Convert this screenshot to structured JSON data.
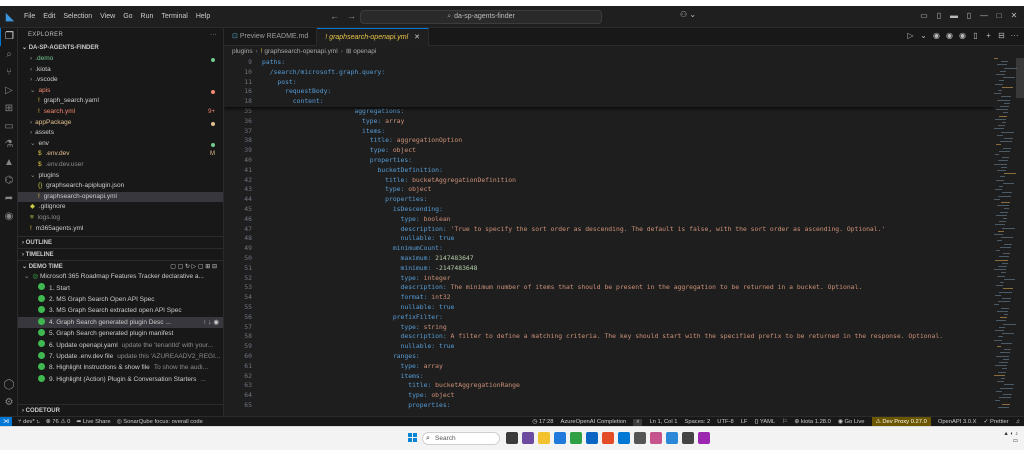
{
  "menu": [
    "File",
    "Edit",
    "Selection",
    "View",
    "Go",
    "Run",
    "Terminal",
    "Help"
  ],
  "command_center": "da-sp-agents-finder",
  "explorer": {
    "header": "EXPLORER",
    "project": "DA-SP-AGENTS-FINDER",
    "items": [
      {
        "label": ".demo",
        "color": "#73c991",
        "indent": 1,
        "chev": "›",
        "mark": "dot-green"
      },
      {
        "label": ".kiota",
        "color": "#cccccc",
        "indent": 1,
        "chev": "›",
        "mark": ""
      },
      {
        "label": ".vscode",
        "color": "#cccccc",
        "indent": 1,
        "chev": "›",
        "mark": ""
      },
      {
        "label": "apis",
        "color": "#f48771",
        "indent": 1,
        "chev": "⌄",
        "mark": "dot-red"
      },
      {
        "label": "graph_search.yaml",
        "color": "#cccccc",
        "indent": 2,
        "icon": "!",
        "mark": ""
      },
      {
        "label": "search.yml",
        "color": "#f48771",
        "indent": 2,
        "icon": "!",
        "mark": "9+"
      },
      {
        "label": "appPackage",
        "color": "#e2c08d",
        "indent": 1,
        "chev": "›",
        "mark": "dot-orange"
      },
      {
        "label": "assets",
        "color": "#cccccc",
        "indent": 1,
        "chev": "›",
        "mark": ""
      },
      {
        "label": "env",
        "color": "#cccccc",
        "indent": 1,
        "chev": "⌄",
        "mark": "dot-green"
      },
      {
        "label": ".env.dev",
        "color": "#e2c08d",
        "indent": 2,
        "icon": "$",
        "mark": "M"
      },
      {
        "label": ".env.dev.user",
        "color": "#8c8c8c",
        "indent": 2,
        "icon": "$",
        "mark": ""
      },
      {
        "label": "plugins",
        "color": "#cccccc",
        "indent": 1,
        "chev": "⌄",
        "mark": ""
      },
      {
        "label": "graphsearch-apiplugin.json",
        "color": "#cccccc",
        "indent": 2,
        "icon": "{}",
        "mark": ""
      },
      {
        "label": "graphsearch-openapi.yml",
        "color": "#cccccc",
        "indent": 2,
        "icon": "!",
        "mark": "",
        "selected": true
      },
      {
        "label": ".gitignore",
        "color": "#cccccc",
        "indent": 1,
        "icon": "◆",
        "mark": ""
      },
      {
        "label": "logs.log",
        "color": "#8c8c8c",
        "indent": 1,
        "icon": "≡",
        "mark": ""
      },
      {
        "label": "m365agents.yml",
        "color": "#cccccc",
        "indent": 1,
        "icon": "!",
        "mark": ""
      }
    ]
  },
  "sections": {
    "outline": "OUTLINE",
    "timeline": "TIMELINE",
    "demo_time": "DEMO TIME",
    "codetour": "CODETOUR"
  },
  "demo": {
    "group": "Microsoft 365 Roadmap Features Tracker declarative a...",
    "steps": [
      {
        "label": "1. Start",
        "desc": ""
      },
      {
        "label": "2. MS Graph Search Open API Spec",
        "desc": ""
      },
      {
        "label": "3. MS Graph Search extracted open API Spec",
        "desc": ""
      },
      {
        "label": "4. Graph Search generated plugin Desc ...",
        "desc": "",
        "selected": true
      },
      {
        "label": "5. Graph Search generated plugin manifest",
        "desc": ""
      },
      {
        "label": "6. Update openapi.yaml",
        "desc": "update the 'tenantId' with your..."
      },
      {
        "label": "7. Update .env.dev file",
        "desc": "update this 'AZUREAADV2_REGI..."
      },
      {
        "label": "8. Highlight Instructions & show file",
        "desc": "To show the audi..."
      },
      {
        "label": "9. Highlight (Action) Plugin & Conversation Starters",
        "desc": "..."
      }
    ]
  },
  "tabs": [
    {
      "label": "Preview README.md",
      "active": false
    },
    {
      "label": "graphsearch-openapi.yml",
      "active": true
    }
  ],
  "breadcrumb": [
    "plugins",
    "graphsearch-openapi.yml",
    "openapi"
  ],
  "sticky_lines": [
    {
      "n": "9",
      "indent": 0,
      "t": [
        [
          "k",
          "paths:"
        ]
      ]
    },
    {
      "n": "10",
      "indent": 1,
      "t": [
        [
          "k",
          "/search/microsoft.graph.query:"
        ]
      ]
    },
    {
      "n": "11",
      "indent": 2,
      "t": [
        [
          "k",
          "post:"
        ]
      ]
    },
    {
      "n": "16",
      "indent": 3,
      "t": [
        [
          "k",
          "requestBody:"
        ]
      ]
    },
    {
      "n": "18",
      "indent": 4,
      "t": [
        [
          "k",
          "content:"
        ]
      ]
    }
  ],
  "code_lines": [
    {
      "n": "35",
      "indent": 12,
      "t": [
        [
          "k",
          "aggregations:"
        ]
      ]
    },
    {
      "n": "36",
      "indent": 13,
      "t": [
        [
          "k",
          "type: "
        ],
        [
          "v",
          "array"
        ]
      ]
    },
    {
      "n": "37",
      "indent": 13,
      "t": [
        [
          "k",
          "items:"
        ]
      ]
    },
    {
      "n": "38",
      "indent": 14,
      "t": [
        [
          "k",
          "title: "
        ],
        [
          "v",
          "aggregationOption"
        ]
      ]
    },
    {
      "n": "39",
      "indent": 14,
      "t": [
        [
          "k",
          "type: "
        ],
        [
          "v",
          "object"
        ]
      ]
    },
    {
      "n": "40",
      "indent": 14,
      "t": [
        [
          "k",
          "properties:"
        ]
      ]
    },
    {
      "n": "41",
      "indent": 15,
      "t": [
        [
          "k",
          "bucketDefinition:"
        ]
      ]
    },
    {
      "n": "42",
      "indent": 16,
      "t": [
        [
          "k",
          "title: "
        ],
        [
          "v",
          "bucketAggregationDefinition"
        ]
      ]
    },
    {
      "n": "43",
      "indent": 16,
      "t": [
        [
          "k",
          "type: "
        ],
        [
          "v",
          "object"
        ]
      ]
    },
    {
      "n": "44",
      "indent": 16,
      "t": [
        [
          "k",
          "properties:"
        ]
      ]
    },
    {
      "n": "45",
      "indent": 17,
      "t": [
        [
          "k",
          "isDescending:"
        ]
      ]
    },
    {
      "n": "46",
      "indent": 18,
      "t": [
        [
          "k",
          "type: "
        ],
        [
          "v",
          "boolean"
        ]
      ]
    },
    {
      "n": "47",
      "indent": 18,
      "t": [
        [
          "k",
          "description: "
        ],
        [
          "v",
          "'True to specify the sort order as descending. The default is false, with the sort order as ascending. Optional.'"
        ]
      ]
    },
    {
      "n": "48",
      "indent": 18,
      "t": [
        [
          "k",
          "nullable: "
        ],
        [
          "b",
          "true"
        ]
      ]
    },
    {
      "n": "49",
      "indent": 17,
      "t": [
        [
          "k",
          "minimumCount:"
        ]
      ]
    },
    {
      "n": "50",
      "indent": 18,
      "t": [
        [
          "k",
          "maximum: "
        ],
        [
          "n",
          "2147483647"
        ]
      ]
    },
    {
      "n": "51",
      "indent": 18,
      "t": [
        [
          "k",
          "minimum: "
        ],
        [
          "n",
          "-2147483648"
        ]
      ]
    },
    {
      "n": "52",
      "indent": 18,
      "t": [
        [
          "k",
          "type: "
        ],
        [
          "v",
          "integer"
        ]
      ]
    },
    {
      "n": "53",
      "indent": 18,
      "t": [
        [
          "k",
          "description: "
        ],
        [
          "v",
          "The minimum number of items that should be present in the aggregation to be returned in a bucket. Optional."
        ]
      ]
    },
    {
      "n": "54",
      "indent": 18,
      "t": [
        [
          "k",
          "format: "
        ],
        [
          "v",
          "int32"
        ]
      ]
    },
    {
      "n": "55",
      "indent": 18,
      "t": [
        [
          "k",
          "nullable: "
        ],
        [
          "b",
          "true"
        ]
      ]
    },
    {
      "n": "56",
      "indent": 17,
      "t": [
        [
          "k",
          "prefixFilter:"
        ]
      ]
    },
    {
      "n": "57",
      "indent": 18,
      "t": [
        [
          "k",
          "type: "
        ],
        [
          "v",
          "string"
        ]
      ]
    },
    {
      "n": "58",
      "indent": 18,
      "t": [
        [
          "k",
          "description: "
        ],
        [
          "v",
          "A filter to define a matching criteria. The key should start with the specified prefix to be returned in the response. Optional."
        ]
      ]
    },
    {
      "n": "59",
      "indent": 18,
      "t": [
        [
          "k",
          "nullable: "
        ],
        [
          "b",
          "true"
        ]
      ]
    },
    {
      "n": "60",
      "indent": 17,
      "t": [
        [
          "k",
          "ranges:"
        ]
      ]
    },
    {
      "n": "61",
      "indent": 18,
      "t": [
        [
          "k",
          "type: "
        ],
        [
          "v",
          "array"
        ]
      ]
    },
    {
      "n": "62",
      "indent": 18,
      "t": [
        [
          "k",
          "items:"
        ]
      ]
    },
    {
      "n": "63",
      "indent": 19,
      "t": [
        [
          "k",
          "title: "
        ],
        [
          "v",
          "bucketAggregationRange"
        ]
      ]
    },
    {
      "n": "64",
      "indent": 19,
      "t": [
        [
          "k",
          "type: "
        ],
        [
          "v",
          "object"
        ]
      ]
    },
    {
      "n": "65",
      "indent": 19,
      "t": [
        [
          "k",
          "properties:"
        ]
      ]
    }
  ],
  "status": {
    "branch": "dev*",
    "problems": "76",
    "warnings": "0",
    "live_share": "Live Share",
    "sonar": "SonarQube focus: overall code",
    "time": "17:28",
    "azure": "AzureOpenAI Completion",
    "position": "Ln 1, Col 1",
    "spaces": "Spaces: 2",
    "encoding": "UTF-8",
    "eol": "LF",
    "language": "YAML",
    "kiota": "kiota 1.28.0",
    "golive": "Go Live",
    "devproxy": "Dev Proxy 0.27.0",
    "openapi": "OpenAPI 3.0.X",
    "prettier": "Prettier"
  },
  "taskbar": {
    "search": "Search"
  },
  "colors": {
    "accent": "#0078d4",
    "success": "#3fb950",
    "editor_bg": "#1e1e1e"
  }
}
